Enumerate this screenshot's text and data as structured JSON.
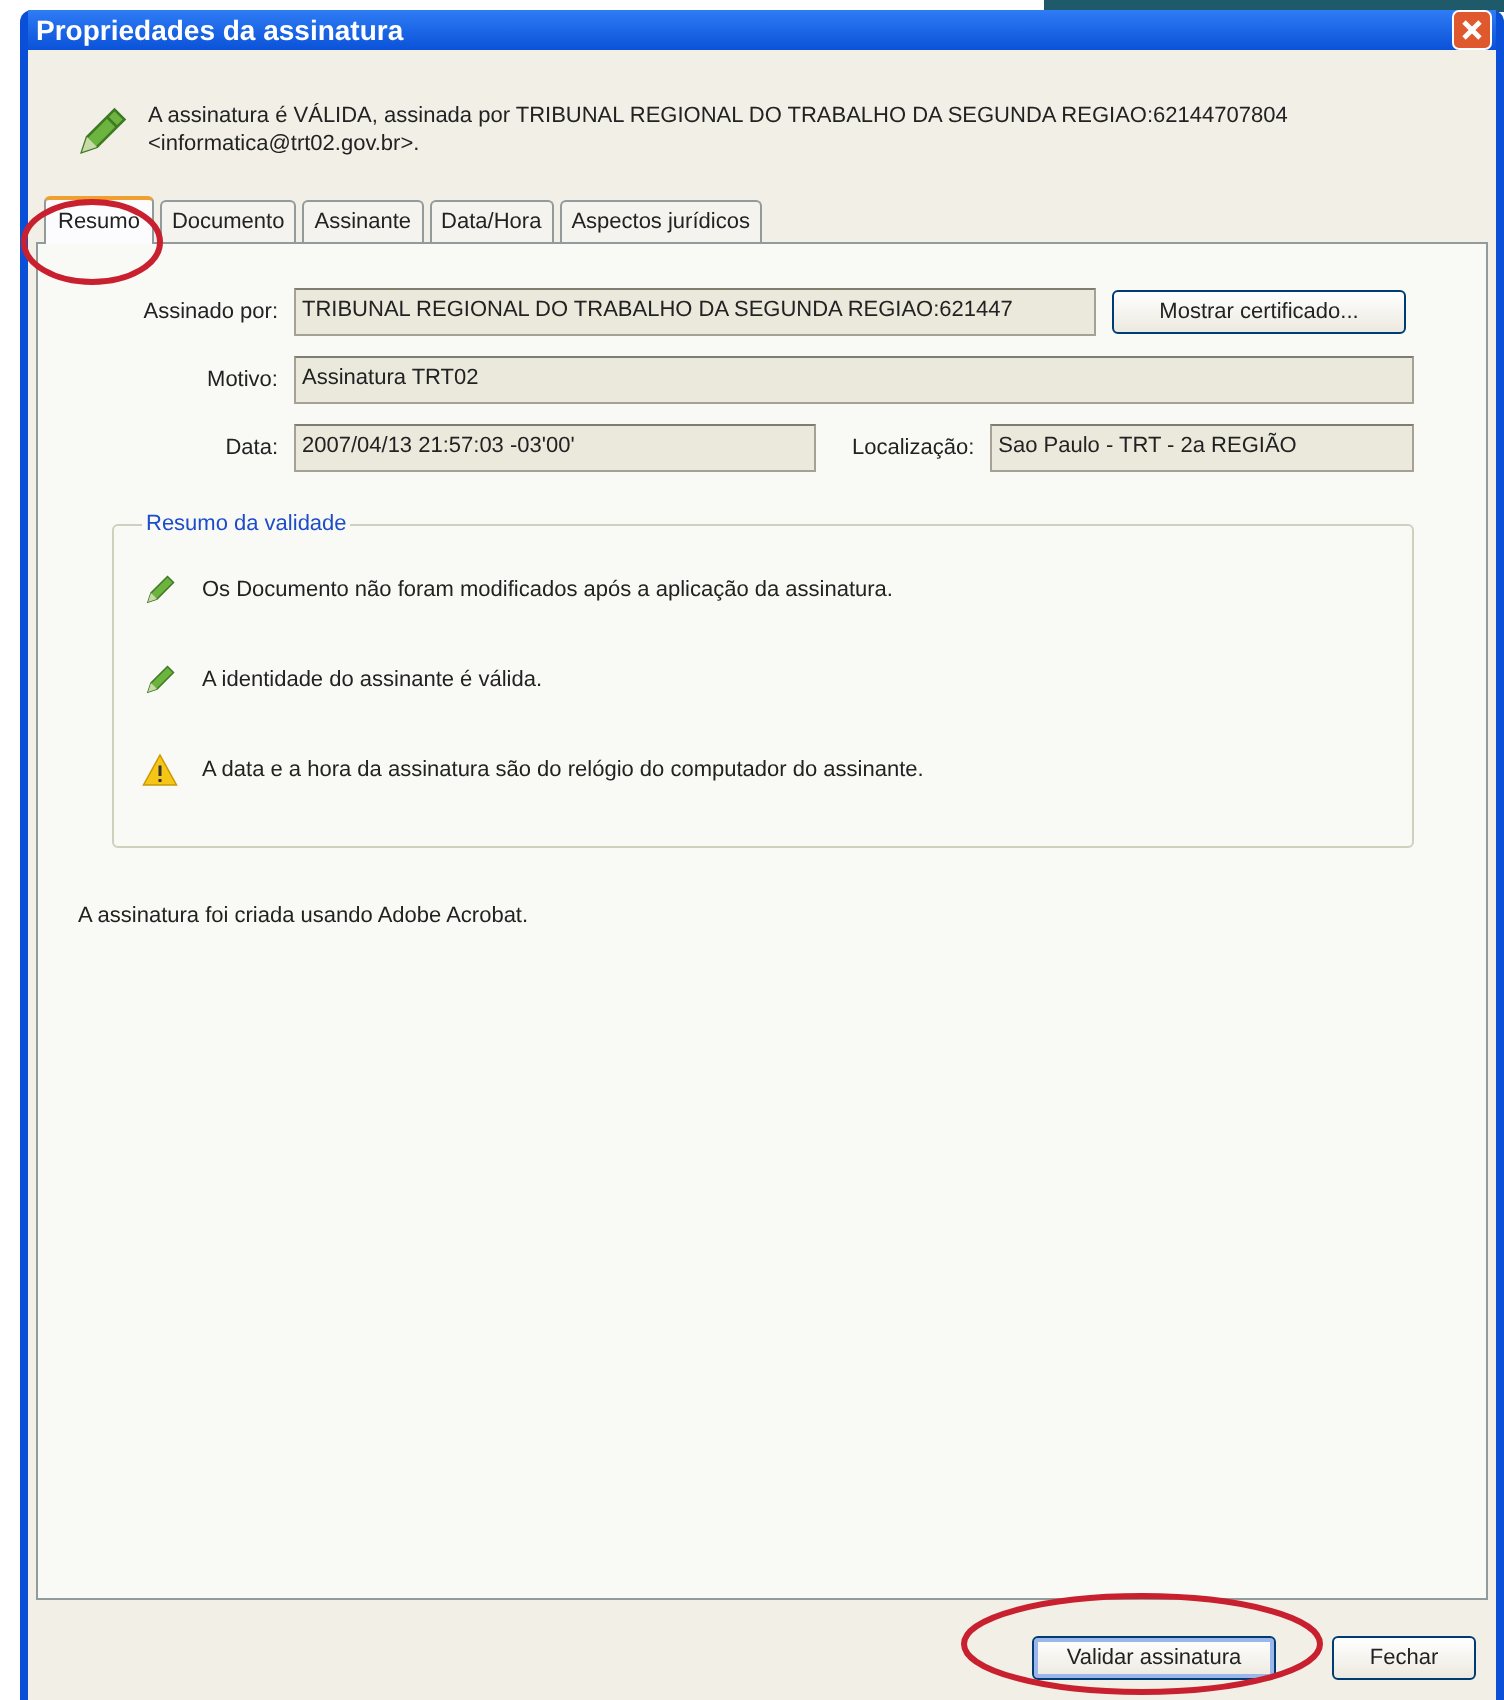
{
  "window": {
    "title": "Propriedades da assinatura"
  },
  "header": {
    "message": "A assinatura é VÁLIDA, assinada por TRIBUNAL REGIONAL DO TRABALHO DA SEGUNDA REGIAO:62144707804 <informatica@trt02.gov.br>."
  },
  "tabs": [
    {
      "label": "Resumo",
      "selected": true
    },
    {
      "label": "Documento",
      "selected": false
    },
    {
      "label": "Assinante",
      "selected": false
    },
    {
      "label": "Data/Hora",
      "selected": false
    },
    {
      "label": "Aspectos jurídicos",
      "selected": false
    }
  ],
  "fields": {
    "signed_by": {
      "label": "Assinado por:",
      "value": "TRIBUNAL REGIONAL DO TRABALHO DA SEGUNDA REGIAO:621447"
    },
    "show_certificate_button": "Mostrar certificado...",
    "reason": {
      "label": "Motivo:",
      "value": "Assinatura TRT02"
    },
    "date": {
      "label": "Data:",
      "value": "2007/04/13 21:57:03 -03'00'"
    },
    "location": {
      "label": "Localização:",
      "value": "Sao Paulo - TRT - 2a REGIÃO"
    }
  },
  "validity_summary": {
    "title": "Resumo da validade",
    "items": [
      {
        "kind": "valid",
        "text": "Os Documento não foram modificados após a aplicação da assinatura."
      },
      {
        "kind": "valid",
        "text": "A identidade do assinante é válida."
      },
      {
        "kind": "warning",
        "text": "A data e a hora da assinatura são do relógio do computador do assinante."
      }
    ]
  },
  "footer_note": "A assinatura foi criada usando Adobe Acrobat.",
  "buttons": [
    "Validar assinatura",
    "Fechar"
  ]
}
